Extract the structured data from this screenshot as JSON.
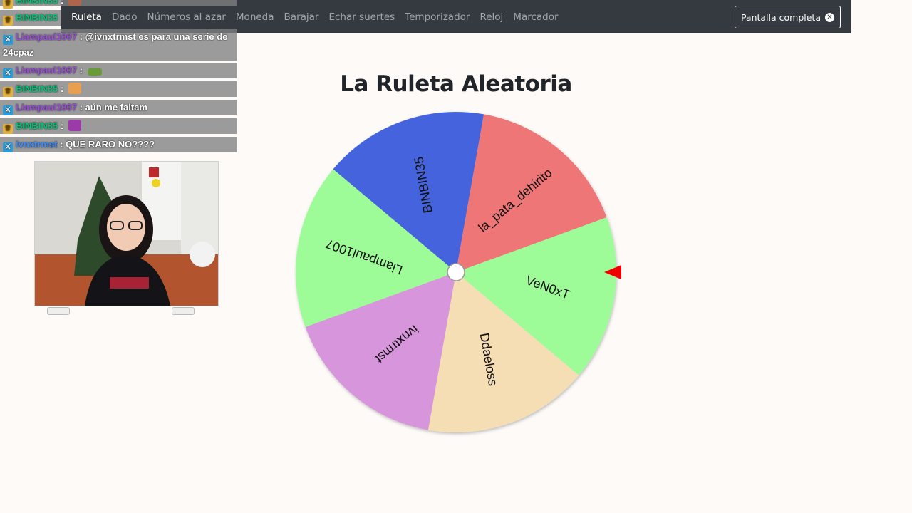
{
  "navbar": {
    "items": [
      {
        "label": "Ruleta",
        "active": true
      },
      {
        "label": "Dado",
        "active": false
      },
      {
        "label": "Números al azar",
        "active": false
      },
      {
        "label": "Moneda",
        "active": false
      },
      {
        "label": "Barajar",
        "active": false
      },
      {
        "label": "Echar suertes",
        "active": false
      },
      {
        "label": "Temporizador",
        "active": false
      },
      {
        "label": "Reloj",
        "active": false
      },
      {
        "label": "Marcador",
        "active": false
      }
    ],
    "fullscreen_label": "Pantalla completa"
  },
  "chat": {
    "messages": [
      {
        "user": "BINBIN35",
        "text": ":",
        "badge": "crown",
        "color": "green"
      },
      {
        "user": "BINBIN35",
        "text": ":",
        "badge": "crown",
        "color": "green"
      },
      {
        "user": "Liampaul1007",
        "text": ": @ivnxtrmst es para una serie de 24cpaz",
        "badge": "sword",
        "color": "purple"
      },
      {
        "user": "Liampaul1007",
        "text": ":",
        "badge": "sword",
        "color": "purple"
      },
      {
        "user": "BINBIN35",
        "text": ":",
        "badge": "crown",
        "color": "green"
      },
      {
        "user": "Liampaul1007",
        "text": ": aún me faltam",
        "badge": "sword",
        "color": "purple"
      },
      {
        "user": "BINBIN35",
        "text": ":",
        "badge": "crown",
        "color": "green"
      },
      {
        "user": "ivnxtrmst",
        "text": ": QUE RARO NO????",
        "badge": "sword",
        "color": "blue"
      }
    ]
  },
  "page": {
    "title": "La Ruleta Aleatoria"
  },
  "wheel": {
    "pointer_color": "#ee0000",
    "segments": [
      {
        "label": "VeN0xT",
        "color": "#9efc98"
      },
      {
        "label": "Ddaeloss",
        "color": "#f5deb3"
      },
      {
        "label": "ivnxtrmst",
        "color": "#d796dc"
      },
      {
        "label": "Liampaul1007",
        "color": "#9efc98"
      },
      {
        "label": "BINBIN35",
        "color": "#4464dc"
      },
      {
        "label": "la_pata_dehirito",
        "color": "#ef7676"
      }
    ]
  }
}
